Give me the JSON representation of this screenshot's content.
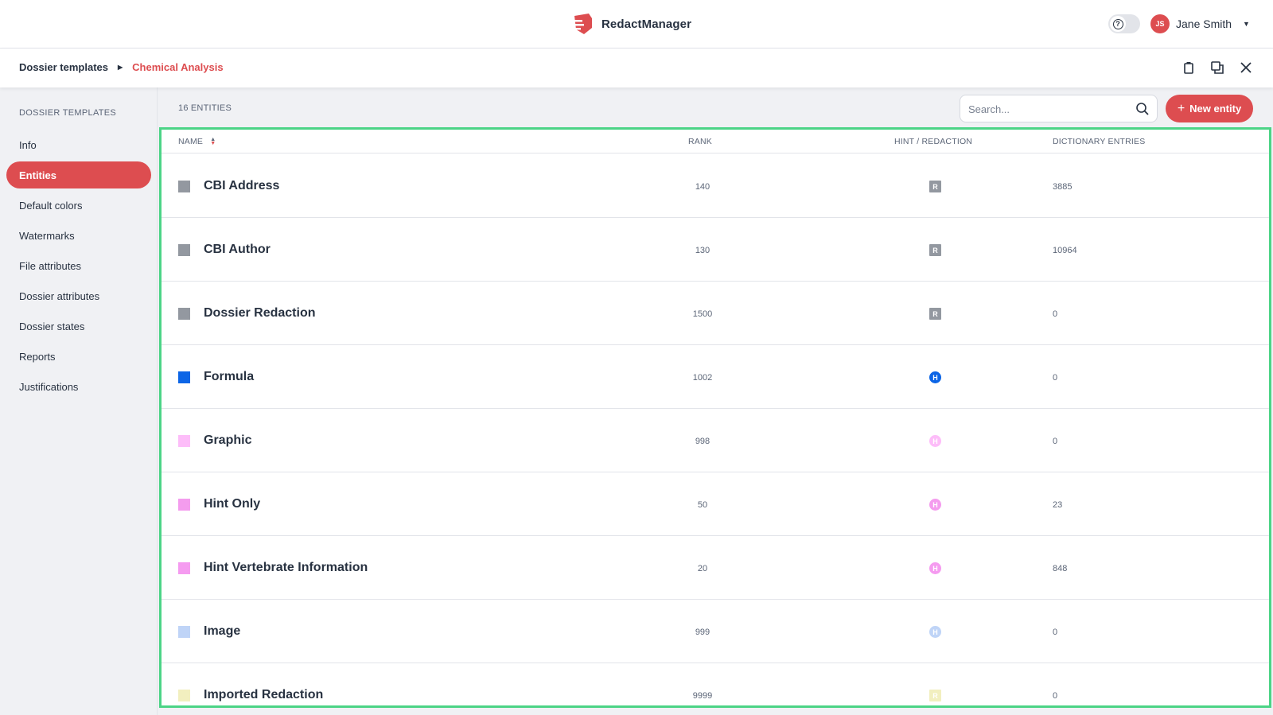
{
  "app": {
    "name": "RedactManager"
  },
  "user": {
    "initials": "JS",
    "name": "Jane Smith"
  },
  "breadcrumb": {
    "root": "Dossier templates",
    "current": "Chemical Analysis"
  },
  "sidebar": {
    "heading": "DOSSIER TEMPLATES",
    "items": [
      {
        "label": "Info",
        "active": false
      },
      {
        "label": "Entities",
        "active": true
      },
      {
        "label": "Default colors",
        "active": false
      },
      {
        "label": "Watermarks",
        "active": false
      },
      {
        "label": "File attributes",
        "active": false
      },
      {
        "label": "Dossier attributes",
        "active": false
      },
      {
        "label": "Dossier states",
        "active": false
      },
      {
        "label": "Reports",
        "active": false
      },
      {
        "label": "Justifications",
        "active": false
      }
    ]
  },
  "main": {
    "count_label": "16 ENTITIES",
    "search_placeholder": "Search...",
    "new_button_label": "New entity",
    "columns": {
      "name": "NAME",
      "rank": "RANK",
      "hint_redaction": "HINT / REDACTION",
      "dictionary_entries": "DICTIONARY ENTRIES"
    },
    "rows": [
      {
        "name": "CBI Address",
        "rank": "140",
        "type": "R",
        "dict": "3885",
        "color": "#9398a0"
      },
      {
        "name": "CBI Author",
        "rank": "130",
        "type": "R",
        "dict": "10964",
        "color": "#9398a0"
      },
      {
        "name": "Dossier Redaction",
        "rank": "1500",
        "type": "R",
        "dict": "0",
        "color": "#9398a0"
      },
      {
        "name": "Formula",
        "rank": "1002",
        "type": "H",
        "dict": "0",
        "color": "#0c65e6"
      },
      {
        "name": "Graphic",
        "rank": "998",
        "type": "H",
        "dict": "0",
        "color": "#fdbdf9"
      },
      {
        "name": "Hint Only",
        "rank": "50",
        "type": "H",
        "dict": "23",
        "color": "#f49cee"
      },
      {
        "name": "Hint Vertebrate Information",
        "rank": "20",
        "type": "H",
        "dict": "848",
        "color": "#f59bf0"
      },
      {
        "name": "Image",
        "rank": "999",
        "type": "H",
        "dict": "0",
        "color": "#bfd4f7"
      },
      {
        "name": "Imported Redaction",
        "rank": "9999",
        "type": "R",
        "dict": "0",
        "color": "#f2efbf"
      }
    ]
  },
  "colors": {
    "accent": "#dd4d50",
    "highlight_border": "#4cd486"
  },
  "icons": {
    "search": "search-icon",
    "copy": "copy-icon",
    "delete": "trash-icon",
    "close": "close-icon",
    "help": "help-icon"
  }
}
